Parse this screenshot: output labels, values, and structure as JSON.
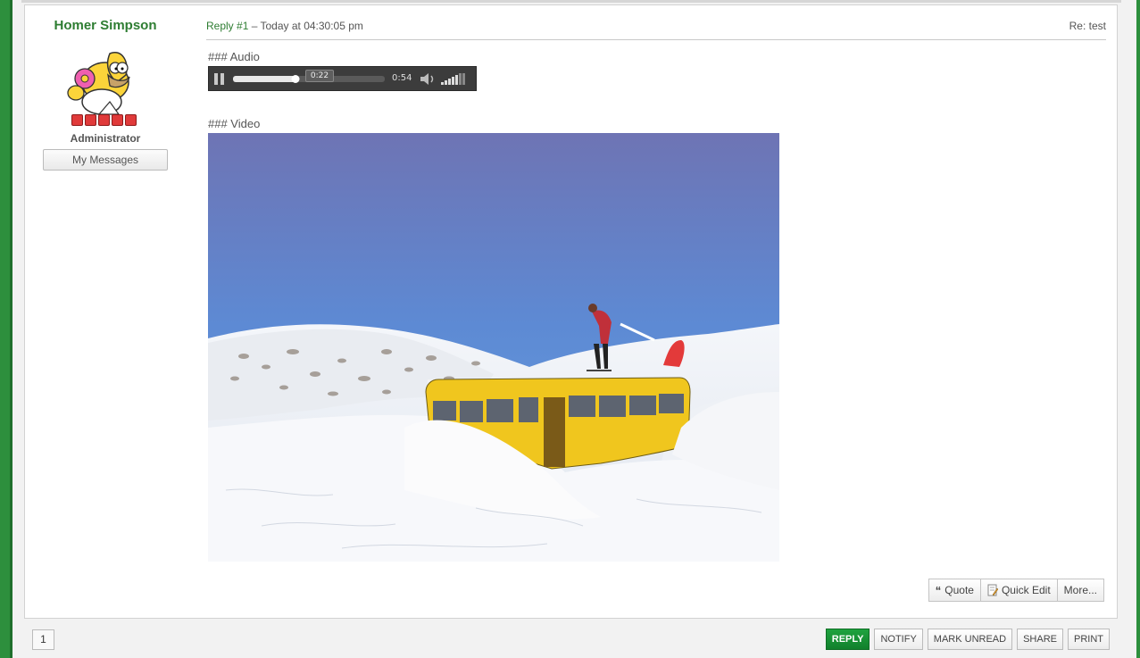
{
  "poster": {
    "name": "Homer Simpson",
    "group": "Administrator",
    "stars": 5,
    "my_messages_label": "My Messages"
  },
  "post": {
    "reply_label": "Reply #1",
    "time": " – Today at 04:30:05 pm",
    "subject": "Re: test",
    "audio_heading": "### Audio",
    "video_heading": "### Video"
  },
  "audio_player": {
    "current_time": "0:22",
    "duration": "0:54",
    "progress": 0.41
  },
  "post_actions": {
    "quote_label": "Quote",
    "quick_edit_label": "Quick Edit",
    "more_label": "More..."
  },
  "pagination": {
    "current_page": "1"
  },
  "bottom_buttons": {
    "reply": "REPLY",
    "notify": "NOTIFY",
    "mark_unread": "MARK UNREAD",
    "share": "SHARE",
    "print": "PRINT"
  },
  "colors": {
    "accent_green": "#2e7d32",
    "reply_button": "#11802c",
    "player_bg": "#3c3c3c"
  }
}
